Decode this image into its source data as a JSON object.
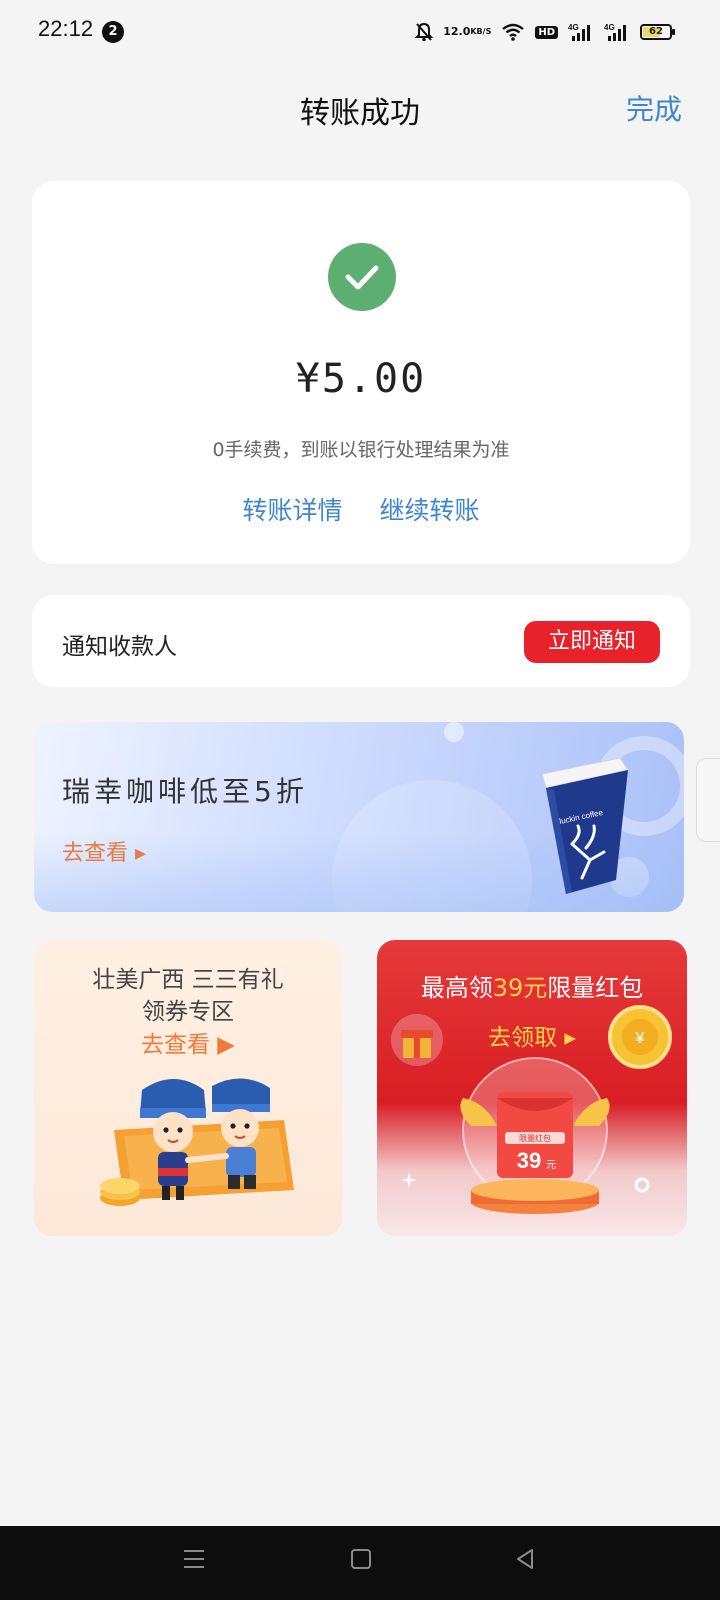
{
  "status_bar": {
    "time": "22:12",
    "notification_count": "2",
    "net_speed_value": "12.0",
    "net_speed_unit": "KB/S",
    "hd_label": "HD",
    "signal1_label": "4G",
    "signal2_label": "4G",
    "battery_level": "62",
    "battery_percent": 62
  },
  "header": {
    "title": "转账成功",
    "done_label": "完成"
  },
  "success": {
    "icon": "check-icon",
    "amount": "¥5.00",
    "fee_note": "0手续费，到账以银行处理结果为准",
    "details_link": "转账详情",
    "continue_link": "继续转账"
  },
  "notify": {
    "label": "通知收款人",
    "button": "立即通知"
  },
  "luckin_banner": {
    "headline": "瑞幸咖啡低至5折",
    "cta": "去查看 ▸",
    "cup_text": "luckin coffee"
  },
  "promo_left": {
    "line1": "壮美广西  三三有礼",
    "line2": "领券专区",
    "cta": "去查看 ▶"
  },
  "promo_right": {
    "prefix": "最高领",
    "highlight": "39元",
    "suffix": "限量红包",
    "cta": "去领取 ▸",
    "envelope_label": "限量红包",
    "envelope_amount": "39",
    "envelope_unit": "元"
  },
  "colors": {
    "accent_blue": "#3f86cf",
    "success_green": "#5dae71",
    "notify_red": "#e8212b",
    "cta_orange": "#e77a47",
    "highlight_yellow": "#ffd24a"
  }
}
